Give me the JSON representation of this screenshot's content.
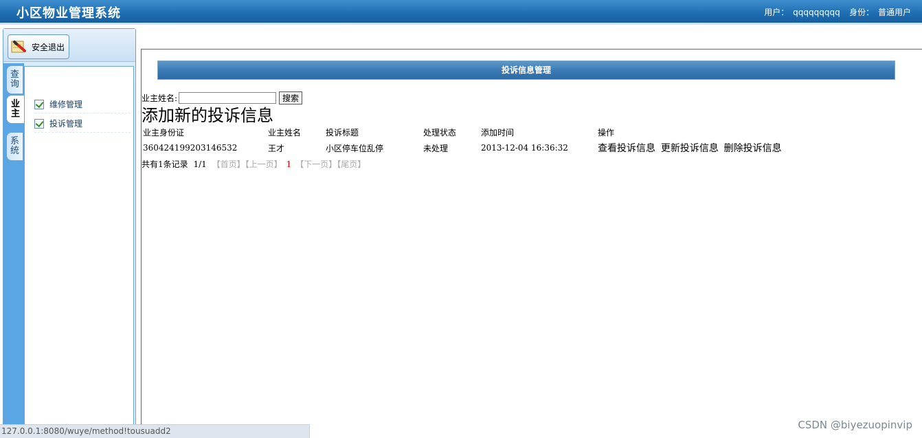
{
  "header": {
    "title": "小区物业管理系统",
    "user_label": "用户：",
    "user_name": "qqqqqqqqq",
    "role_label": "身份：",
    "role_name": "普通用户"
  },
  "sidebar": {
    "logout_label": "安全退出",
    "tabs": [
      {
        "label": "查询"
      },
      {
        "label": "业主"
      },
      {
        "label": "系统"
      }
    ],
    "items": [
      {
        "label": "维修管理"
      },
      {
        "label": "投诉管理"
      }
    ]
  },
  "main": {
    "panel_title": "投诉信息管理",
    "search_label": "业主姓名:",
    "search_value": "",
    "search_button": "搜索",
    "add_link": "添加新的投诉信息",
    "table": {
      "headers": [
        "业主身份证",
        "业主姓名",
        "投诉标题",
        "处理状态",
        "添加时间",
        "操作"
      ],
      "rows": [
        {
          "id_card": "360424199203146532",
          "owner": "王才",
          "title": "小区停车位乱停",
          "status": "未处理",
          "time": "2013-12-04 16:36:32",
          "ops": [
            "查看投诉信息",
            "更新投诉信息",
            "删除投诉信息"
          ]
        }
      ]
    },
    "pager": {
      "total": "共有1条记录",
      "page": "1/1",
      "first": "【首页】",
      "prev": "【上一页】",
      "current": "1",
      "next": "【下一页】",
      "last": "【尾页】"
    }
  },
  "statusbar": {
    "url": "127.0.0.1:8080/wuye/method!tousuadd2"
  },
  "watermark": "CSDN @biyezuopinvip"
}
